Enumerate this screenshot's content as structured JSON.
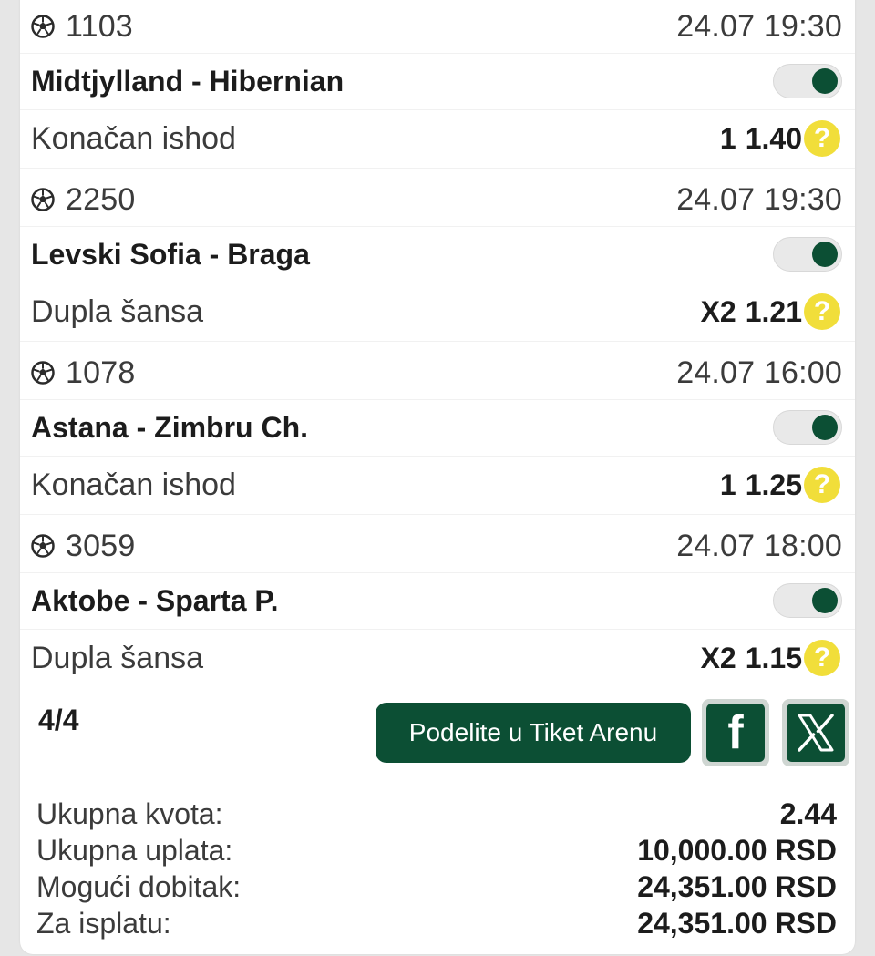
{
  "matches": [
    {
      "code": "1103",
      "date": "24.07 19:30",
      "teams": "Midtjylland - Hibernian",
      "bet_type": "Konačan ishod",
      "pick": "1",
      "odd": "1.40",
      "enabled": true
    },
    {
      "code": "2250",
      "date": "24.07 19:30",
      "teams": "Levski Sofia - Braga",
      "bet_type": "Dupla šansa",
      "pick": "X2",
      "odd": "1.21",
      "enabled": true
    },
    {
      "code": "1078",
      "date": "24.07 16:00",
      "teams": "Astana - Zimbru Ch.",
      "bet_type": "Konačan ishod",
      "pick": "1",
      "odd": "1.25",
      "enabled": true
    },
    {
      "code": "3059",
      "date": "24.07 18:00",
      "teams": "Aktobe - Sparta P.",
      "bet_type": "Dupla šansa",
      "pick": "X2",
      "odd": "1.15",
      "enabled": true
    }
  ],
  "help_symbol": "?",
  "footer": {
    "count": "4/4",
    "share_label": "Podelite u Tiket Arenu",
    "facebook_glyph": "f"
  },
  "summary": {
    "total_odds_label": "Ukupna kvota:",
    "total_odds_value": "2.44",
    "stake_label": "Ukupna uplata:",
    "stake_value": "10,000.00 RSD",
    "possible_win_label": "Mogući dobitak:",
    "possible_win_value": "24,351.00 RSD",
    "payout_label": "Za isplatu:",
    "payout_value": "24,351.00 RSD"
  },
  "colors": {
    "brand_green": "#0c4f34",
    "help_yellow": "#f1de3a"
  }
}
